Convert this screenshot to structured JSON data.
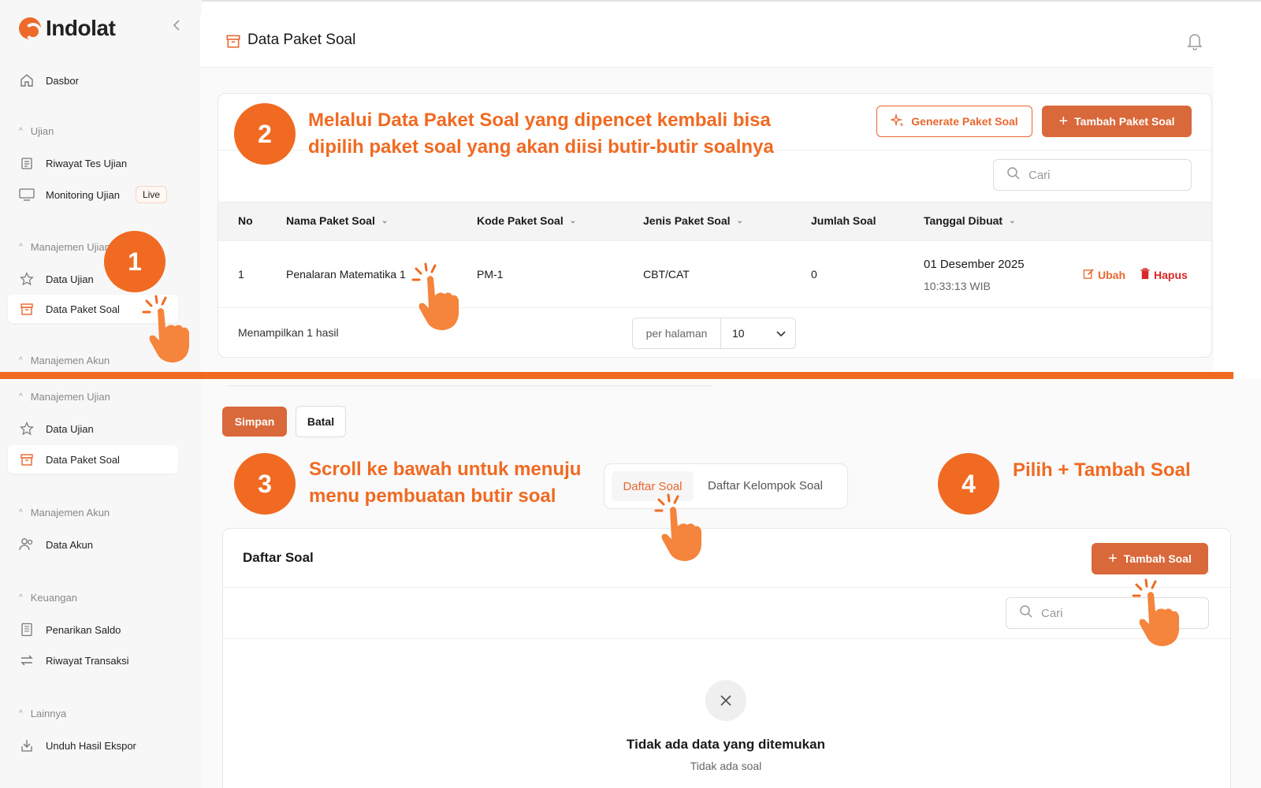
{
  "brand": {
    "name": "Indolat",
    "accent": "#e8672e",
    "tutorial_orange": "#f06a22"
  },
  "sidebar_top": {
    "dasbor": "Dasbor",
    "sec_ujian": "Ujian",
    "riwayat_tes": "Riwayat Tes Ujian",
    "monitoring": "Monitoring Ujian",
    "live_badge": "Live",
    "sec_manajemen_ujian": "Manajemen Ujian",
    "data_ujian": "Data Ujian",
    "data_paket_soal": "Data Paket Soal",
    "sec_manajemen_akun": "Manajemen Akun"
  },
  "sidebar_bottom": {
    "sec_manajemen_ujian": "Manajemen Ujian",
    "data_ujian": "Data Ujian",
    "data_paket_soal": "Data Paket Soal",
    "sec_manajemen_akun": "Manajemen Akun",
    "data_akun": "Data Akun",
    "sec_keuangan": "Keuangan",
    "penarikan": "Penarikan Saldo",
    "riwayat_transaksi": "Riwayat Transaksi",
    "sec_lainnya": "Lainnya",
    "unduh": "Unduh Hasil Ekspor"
  },
  "header": {
    "title": "Data Paket Soal"
  },
  "toolbar": {
    "generate": "Generate Paket Soal",
    "tambah_paket": "Tambah Paket Soal",
    "search_placeholder": "Cari"
  },
  "table": {
    "columns": [
      "No",
      "Nama Paket Soal",
      "Kode Paket Soal",
      "Jenis Paket Soal",
      "Jumlah Soal",
      "Tanggal Dibuat"
    ],
    "rows": [
      {
        "no": "1",
        "nama": "Penalaran Matematika 1",
        "kode": "PM-1",
        "jenis": "CBT/CAT",
        "jumlah": "0",
        "tanggal": "01 Desember 2025",
        "waktu": "10:33:13 WIB",
        "ubah": "Ubah",
        "hapus": "Hapus"
      }
    ],
    "result_text": "Menampilkan 1 hasil",
    "per_page_label": "per halaman",
    "per_page_value": "10"
  },
  "form": {
    "simpan": "Simpan",
    "batal": "Batal",
    "tabs": [
      "Daftar Soal",
      "Daftar Kelompok Soal"
    ],
    "list_title": "Daftar Soal",
    "tambah_soal": "Tambah Soal",
    "search_placeholder": "Cari",
    "empty_title": "Tidak ada data yang ditemukan",
    "empty_subtitle": "Tidak ada soal"
  },
  "tutorial": {
    "steps": [
      {
        "num": "1",
        "text": ""
      },
      {
        "num": "2",
        "text_line1": "Melalui Data Paket Soal yang dipencet kembali bisa",
        "text_line2": "dipilih paket soal yang akan diisi butir-butir soalnya"
      },
      {
        "num": "3",
        "text_line1": "Scroll ke bawah untuk menuju",
        "text_line2": "menu pembuatan butir soal"
      },
      {
        "num": "4",
        "text_line1": "Pilih + Tambah Soal"
      }
    ]
  }
}
